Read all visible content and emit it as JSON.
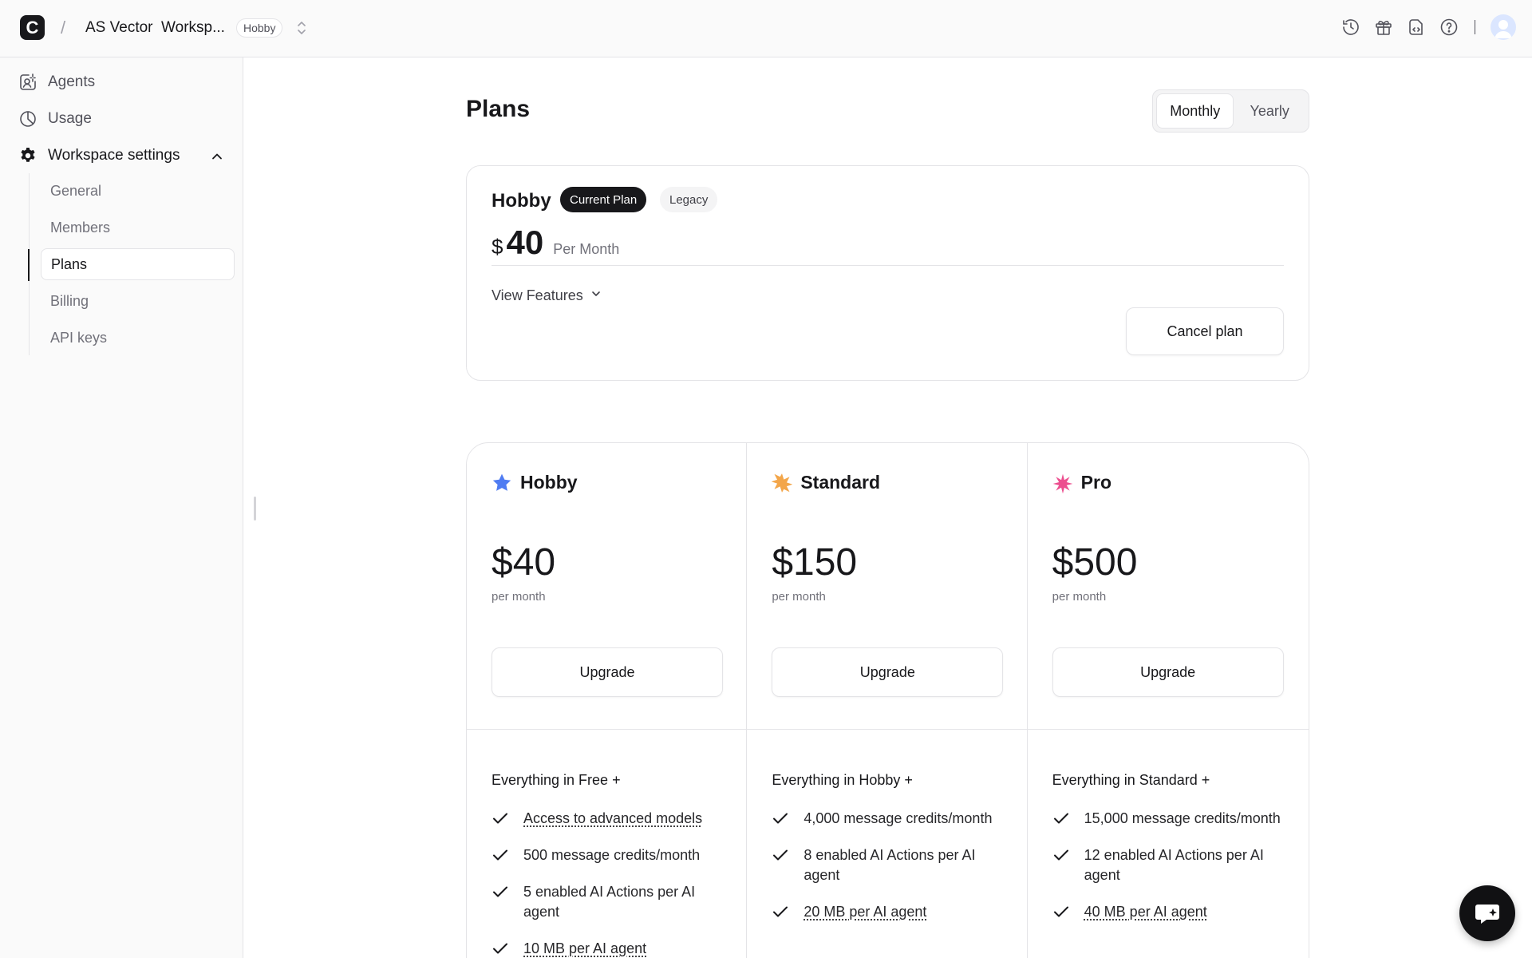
{
  "topbar": {
    "logo_letter": "C",
    "separator": "/",
    "workspace_name": "AS Vector  Worksp...",
    "plan_badge": "Hobby",
    "icons": [
      "history-icon",
      "gift-icon",
      "code-file-icon",
      "help-icon"
    ],
    "divider": "|"
  },
  "sidebar": {
    "items": [
      {
        "label": "Agents",
        "icon": "agents-icon"
      },
      {
        "label": "Usage",
        "icon": "usage-pie-icon"
      },
      {
        "label": "Workspace settings",
        "icon": "gear-icon"
      }
    ],
    "sub_items": [
      {
        "label": "General"
      },
      {
        "label": "Members"
      },
      {
        "label": "Plans",
        "active": true
      },
      {
        "label": "Billing"
      },
      {
        "label": "API keys"
      }
    ]
  },
  "main": {
    "title": "Plans",
    "billing_toggle": {
      "options": [
        "Monthly",
        "Yearly"
      ],
      "selected": "Monthly"
    },
    "current_plan": {
      "name": "Hobby",
      "badge_current": "Current Plan",
      "badge_legacy": "Legacy",
      "currency": "$",
      "amount": "40",
      "period": "Per Month",
      "view_features": "View Features",
      "cancel_label": "Cancel plan"
    },
    "plans": [
      {
        "name": "Hobby",
        "star_color": "#4f7cf2",
        "price": "$40",
        "period": "per month",
        "button": "Upgrade",
        "intro": "Everything in Free +",
        "features": [
          {
            "text": "Access to advanced models",
            "underline": true
          },
          {
            "text": "500 message credits/month",
            "underline": false
          },
          {
            "text": "5 enabled AI Actions per AI agent",
            "underline": false
          },
          {
            "text": "10 MB per AI agent",
            "underline": true
          }
        ]
      },
      {
        "name": "Standard",
        "star_color": "#f3a64a",
        "price": "$150",
        "period": "per month",
        "button": "Upgrade",
        "intro": "Everything in Hobby +",
        "features": [
          {
            "text": "4,000 message credits/month",
            "underline": false
          },
          {
            "text": "8 enabled AI Actions per AI agent",
            "underline": false
          },
          {
            "text": "20 MB per AI agent",
            "underline": true
          }
        ]
      },
      {
        "name": "Pro",
        "star_color": "#ec4f8f",
        "price": "$500",
        "period": "per month",
        "button": "Upgrade",
        "intro": "Everything in Standard +",
        "features": [
          {
            "text": "15,000 message credits/month",
            "underline": false
          },
          {
            "text": "12 enabled AI Actions per AI agent",
            "underline": false
          },
          {
            "text": "40 MB per AI agent",
            "underline": true
          }
        ]
      }
    ]
  },
  "chat_widget": {
    "icon": "chat-sparkle-icon"
  }
}
